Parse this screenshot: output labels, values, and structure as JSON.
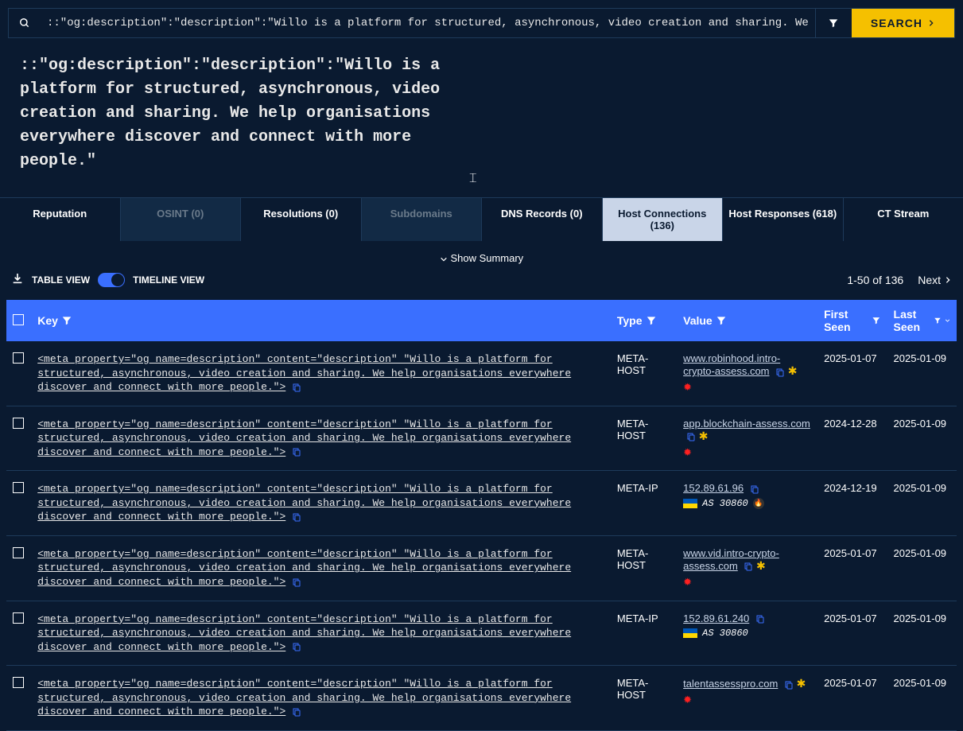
{
  "search": {
    "value": "::\"og:description\":\"description\":\"Willo is a platform for structured, asynchronous, video creation and sharing. We help",
    "button": "SEARCH"
  },
  "query_display": "::\"og:description\":\"description\":\"Willo is a platform for structured, asynchronous, video creation and sharing. We help organisations everywhere discover and connect with more people.\"",
  "tabs": [
    {
      "label": "Reputation",
      "state": "normal"
    },
    {
      "label": "OSINT (0)",
      "state": "disabled"
    },
    {
      "label": "Resolutions (0)",
      "state": "normal"
    },
    {
      "label": "Subdomains",
      "state": "disabled"
    },
    {
      "label": "DNS Records (0)",
      "state": "normal"
    },
    {
      "label": "Host Connections (136)",
      "state": "active"
    },
    {
      "label": "Host Responses (618)",
      "state": "normal"
    },
    {
      "label": "CT Stream",
      "state": "normal"
    }
  ],
  "controls": {
    "show_summary": "Show Summary",
    "table_view": "TABLE VIEW",
    "timeline_view": "TIMELINE VIEW",
    "page_info": "1-50 of 136",
    "next": "Next"
  },
  "columns": {
    "key": "Key",
    "type": "Type",
    "value": "Value",
    "first_seen": "First Seen",
    "last_seen": "Last Seen"
  },
  "key_text": "<meta property=\"og name=description\" content=\"description\" \"Willo is a platform for structured, asynchronous, video creation and sharing. We help organisations everywhere discover and connect with more people.\">",
  "rows": [
    {
      "type": "META-HOST",
      "value": "www.robinhood.intro-crypto-assess.com",
      "flags": [
        "copy",
        "star",
        "virus"
      ],
      "first_seen": "2025-01-07",
      "last_seen": "2025-01-09"
    },
    {
      "type": "META-HOST",
      "value": "app.blockchain-assess.com",
      "flags": [
        "copy",
        "star",
        "virus"
      ],
      "first_seen": "2024-12-28",
      "last_seen": "2025-01-09"
    },
    {
      "type": "META-IP",
      "value": "152.89.61.96",
      "flags": [
        "copy"
      ],
      "extra": {
        "flag": "ua",
        "as": "AS 30860",
        "fire": true
      },
      "first_seen": "2024-12-19",
      "last_seen": "2025-01-09"
    },
    {
      "type": "META-HOST",
      "value": "www.vid.intro-crypto-assess.com",
      "flags": [
        "copy",
        "star",
        "virus"
      ],
      "first_seen": "2025-01-07",
      "last_seen": "2025-01-09"
    },
    {
      "type": "META-IP",
      "value": "152.89.61.240",
      "flags": [
        "copy"
      ],
      "extra": {
        "flag": "ua",
        "as": "AS 30860"
      },
      "first_seen": "2025-01-07",
      "last_seen": "2025-01-09"
    },
    {
      "type": "META-HOST",
      "value": "talentassesspro.com",
      "flags": [
        "copy",
        "star",
        "virus"
      ],
      "first_seen": "2025-01-07",
      "last_seen": "2025-01-09"
    }
  ]
}
